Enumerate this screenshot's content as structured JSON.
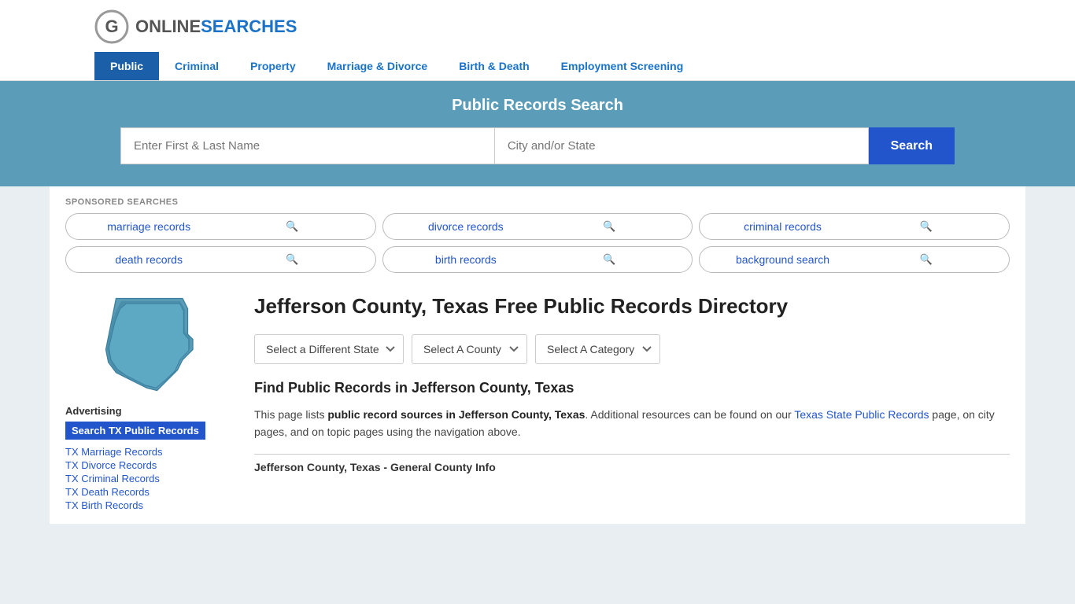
{
  "logo": {
    "online": "ONLINE",
    "searches": "SEARCHES"
  },
  "nav": {
    "items": [
      {
        "label": "Public",
        "active": true
      },
      {
        "label": "Criminal",
        "active": false
      },
      {
        "label": "Property",
        "active": false
      },
      {
        "label": "Marriage & Divorce",
        "active": false
      },
      {
        "label": "Birth & Death",
        "active": false
      },
      {
        "label": "Employment Screening",
        "active": false
      }
    ]
  },
  "search_banner": {
    "title": "Public Records Search",
    "name_placeholder": "Enter First & Last Name",
    "location_placeholder": "City and/or State",
    "search_button": "Search"
  },
  "sponsored": {
    "label": "SPONSORED SEARCHES",
    "items": [
      {
        "label": "marriage records"
      },
      {
        "label": "divorce records"
      },
      {
        "label": "criminal records"
      },
      {
        "label": "death records"
      },
      {
        "label": "birth records"
      },
      {
        "label": "background search"
      }
    ]
  },
  "page": {
    "title": "Jefferson County, Texas Free Public Records Directory",
    "dropdowns": {
      "state": "Select a Different State",
      "county": "Select A County",
      "category": "Select A Category"
    },
    "find_title": "Find Public Records in Jefferson County, Texas",
    "find_text_1": "This page lists ",
    "find_bold": "public record sources in Jefferson County, Texas",
    "find_text_2": ". Additional resources can be found on our ",
    "find_link_text": "Texas State Public Records",
    "find_text_3": " page, on city pages, and on topic pages using the navigation above.",
    "county_info_label": "Jefferson County, Texas - General County Info"
  },
  "advertising": {
    "label": "Advertising",
    "highlight": "Search TX Public Records",
    "links": [
      "TX Marriage Records",
      "TX Divorce Records",
      "TX Criminal Records",
      "TX Death Records",
      "TX Birth Records"
    ]
  }
}
